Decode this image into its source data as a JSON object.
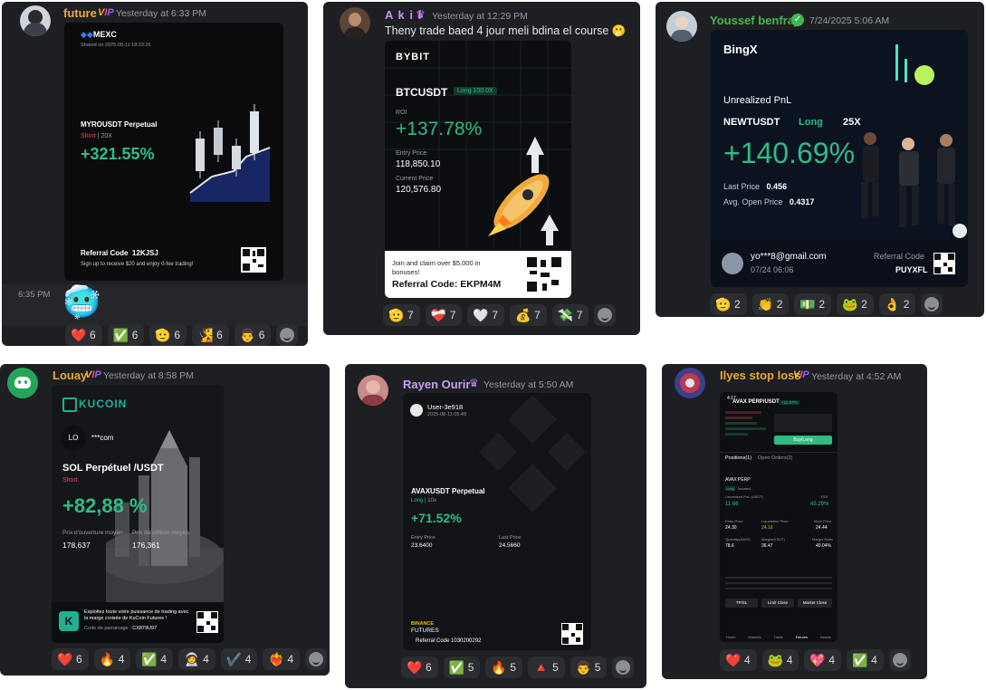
{
  "messages": [
    {
      "user": "future",
      "badge": "VIP",
      "time": "Yesterday at 6:33 PM",
      "card": {
        "brand": "MEXC",
        "shared": "Shared on 2025-08-11 18:33:26",
        "pair": "MYROUSDT Perpetual",
        "side": "Short",
        "leverage": "20X",
        "pnl": "+321.55%",
        "ref_label": "Referral Code",
        "ref_code": "12KJSJ",
        "promo": "Sign up to receive $20 and enjoy 0-fee trading!"
      },
      "followup_time": "6:35 PM",
      "followup_emoji": "🥶",
      "reactions": [
        {
          "emoji": "❤️",
          "count": "6"
        },
        {
          "emoji": "✅",
          "count": "6"
        },
        {
          "emoji": "🫡",
          "count": "6"
        },
        {
          "emoji": "🧏",
          "count": "6"
        },
        {
          "emoji": "👨",
          "count": "6"
        }
      ]
    },
    {
      "user": "A k i l",
      "time": "Yesterday at 12:29 PM",
      "text": "Theny  trade baed 4 jour meli bdina el course 🫢",
      "card": {
        "brand": "BYBIT",
        "pair": "BTCUSDT",
        "tag": "Long 100.0X",
        "roi_label": "ROI",
        "roi": "+137.78%",
        "entry_label": "Entry Price",
        "entry": "118,850.10",
        "current_label": "Current Price",
        "current": "120,576.80",
        "promo": "Join and claim over $5,000 in bonuses!",
        "ref": "Referral Code: EKPM4M"
      },
      "reactions": [
        {
          "emoji": "🫡",
          "count": "7"
        },
        {
          "emoji": "❤️‍🩹",
          "count": "7"
        },
        {
          "emoji": "🤍",
          "count": "7"
        },
        {
          "emoji": "💰",
          "count": "7"
        },
        {
          "emoji": "💸",
          "count": "7"
        }
      ]
    },
    {
      "user": "Youssef benfraj",
      "time": "7/24/2025 5:06 AM",
      "card": {
        "brand": "BingX",
        "heading": "Unrealized PnL",
        "pair": "NEWTUSDT",
        "side": "Long",
        "leverage": "25X",
        "pnl": "+140.69%",
        "last_label": "Last Price",
        "last": "0.456",
        "open_label": "Avg. Open Price",
        "open": "0.4317",
        "email": "yo***8@gmail.com",
        "date": "07/24 06:06",
        "ref_label": "Referral Code",
        "ref_code": "PUYXFL"
      },
      "reactions": [
        {
          "emoji": "🫡",
          "count": "2"
        },
        {
          "emoji": "👏",
          "count": "2"
        },
        {
          "emoji": "💵",
          "count": "2"
        },
        {
          "emoji": "🐸",
          "count": "2"
        },
        {
          "emoji": "👌",
          "count": "2"
        }
      ]
    },
    {
      "user": "Louay",
      "badge": "VIP",
      "time": "Yesterday at 8:58 PM",
      "card": {
        "brand": "KUCOIN",
        "initials": "LO",
        "email": "***com",
        "pair": "SOL Perpétuel /USDT",
        "side": "Short",
        "pnl": "+82,88 %",
        "open_label": "Prix d'ouverture moyen",
        "open": "178,637",
        "close_label": "Prix de clôture moyen",
        "close": "176,361",
        "promo": "Exploitez toute votre puissance de trading avec la marge croisée de KuCoin Futures !",
        "ref_label": "Code de parrainage :",
        "ref_code": "CX879U97"
      },
      "reactions": [
        {
          "emoji": "❤️",
          "count": "6"
        },
        {
          "emoji": "🔥",
          "count": "4"
        },
        {
          "emoji": "✅",
          "count": "4"
        },
        {
          "emoji": "🧑‍🚀",
          "count": "4"
        },
        {
          "emoji": "✔️",
          "count": "4"
        },
        {
          "emoji": "❤️‍🔥",
          "count": "4"
        }
      ]
    },
    {
      "user": "Rayen Ourir",
      "time": "Yesterday at 5:50 AM",
      "card": {
        "user": "User-3e918",
        "date": "2025-08-11 05:49",
        "pair": "AVAXUSDT Perpetual",
        "side": "Long",
        "leverage": "10x",
        "pnl": "+71.52%",
        "entry_label": "Entry Price",
        "entry": "23.6400",
        "last_label": "Last Price",
        "last": "24.5660",
        "brand": "BINANCE",
        "brand2": "FUTURES",
        "ref": "Referral Code 1030200292"
      },
      "reactions": [
        {
          "emoji": "❤️",
          "count": "6"
        },
        {
          "emoji": "✅",
          "count": "5"
        },
        {
          "emoji": "🔥",
          "count": "5"
        },
        {
          "emoji": "🔺",
          "count": "5"
        },
        {
          "emoji": "👨",
          "count": "5"
        }
      ]
    },
    {
      "user": "Ilyes stop loss",
      "badge": "VIP",
      "time": "Yesterday at 4:52 AM",
      "card": {
        "clock": "4:17",
        "pair": "AVAX PERP/USDT",
        "change": "+11.87%",
        "buy": "Buy/Long",
        "positions": "Positions(1)",
        "orders": "Open Orders(2)",
        "pos_pair": "AVAX PERP",
        "pos_tag": "Long",
        "pos_mode": "Isolated",
        "pnl_label": "Unrealized PnL (USDT)",
        "roi_label": "ROI",
        "pnl": "11.66",
        "roi": "43.29%",
        "entry_label": "Entry Price",
        "entry": "24.30",
        "liq_label": "Liquidation Price",
        "liq": "24.16",
        "mark_label": "Mark Price",
        "mark": "24.44",
        "size_label": "Quantity(AVAX)",
        "size": "78.6",
        "margin_label": "Margin(USDT)",
        "margin": "36.47",
        "ratio_label": "Margin Ratio",
        "ratio": "40.04%",
        "btn1": "TP/SL",
        "btn2": "Limit Close",
        "btn3": "Market Close",
        "nav": [
          "Home",
          "Markets",
          "Trade",
          "Futures",
          "Assets"
        ]
      },
      "reactions": [
        {
          "emoji": "❤️",
          "count": "4"
        },
        {
          "emoji": "🐸",
          "count": "4"
        },
        {
          "emoji": "💖",
          "count": "4"
        },
        {
          "emoji": "✅",
          "count": "4"
        }
      ]
    }
  ]
}
